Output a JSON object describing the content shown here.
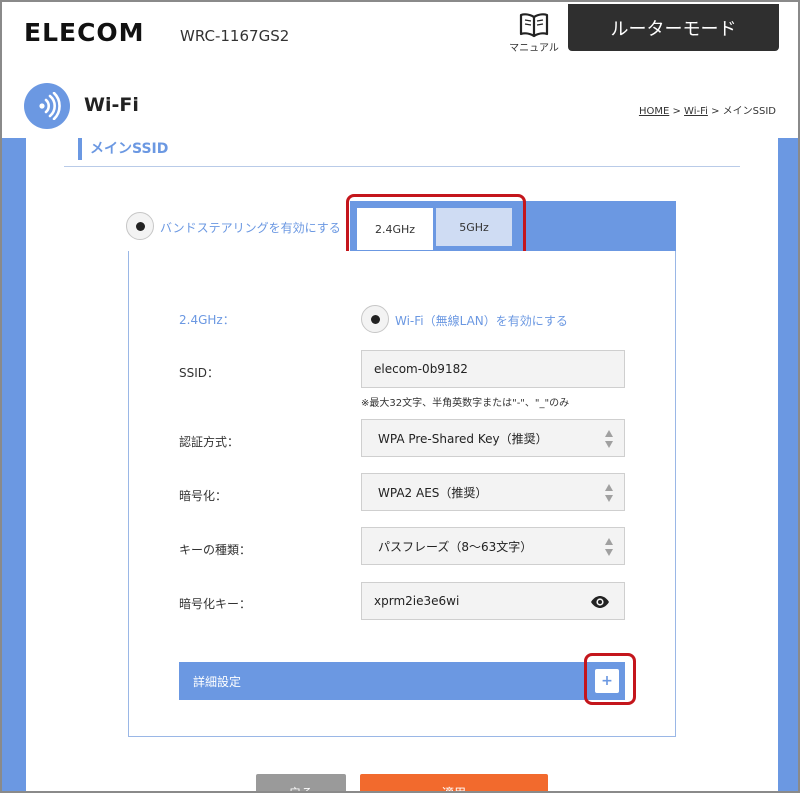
{
  "header": {
    "logo": "ELECOM",
    "model": "WRC-1167GS2",
    "manual_label": "マニュアル",
    "mode_label": "ルーターモード"
  },
  "titlebar": {
    "title": "Wi-Fi",
    "breadcrumb": {
      "home": "HOME",
      "sep1": " > ",
      "wifi": "Wi-Fi",
      "sep2": " > ",
      "current": "メインSSID"
    }
  },
  "section": {
    "title": "メインSSID"
  },
  "band_steering": {
    "label": "バンドステアリングを有効にする"
  },
  "tabs": [
    {
      "label": "2.4GHz",
      "active": true
    },
    {
      "label": "5GHz",
      "active": false
    }
  ],
  "form": {
    "band_label": "2.4GHz：",
    "wifi_enable_label": "Wi-Fi（無線LAN）を有効にする",
    "ssid_label": "SSID：",
    "ssid_value": "elecom-0b9182",
    "ssid_note": "※最大32文字、半角英数字または\"-\"、\"_\"のみ",
    "auth_label": "認証方式：",
    "auth_value": "WPA Pre-Shared Key（推奨）",
    "enc_label": "暗号化：",
    "enc_value": "WPA2 AES（推奨）",
    "keytype_label": "キーの種類：",
    "keytype_value": "パスフレーズ（8～63文字）",
    "key_label": "暗号化キー：",
    "key_value": "xprm2ie3e6wi"
  },
  "detail": {
    "label": "詳細設定",
    "plus": "+"
  },
  "buttons": {
    "back": "戻る",
    "apply": "適用"
  },
  "colors": {
    "accent": "#6b98e2",
    "highlight": "#c4161c",
    "apply": "#f26a2d",
    "back": "#9a9a9a",
    "mode_button": "#2f2f2f"
  },
  "icons": [
    "manual-book-icon",
    "wifi-signal-icon",
    "select-arrows-icon",
    "eye-icon",
    "plus-icon"
  ]
}
